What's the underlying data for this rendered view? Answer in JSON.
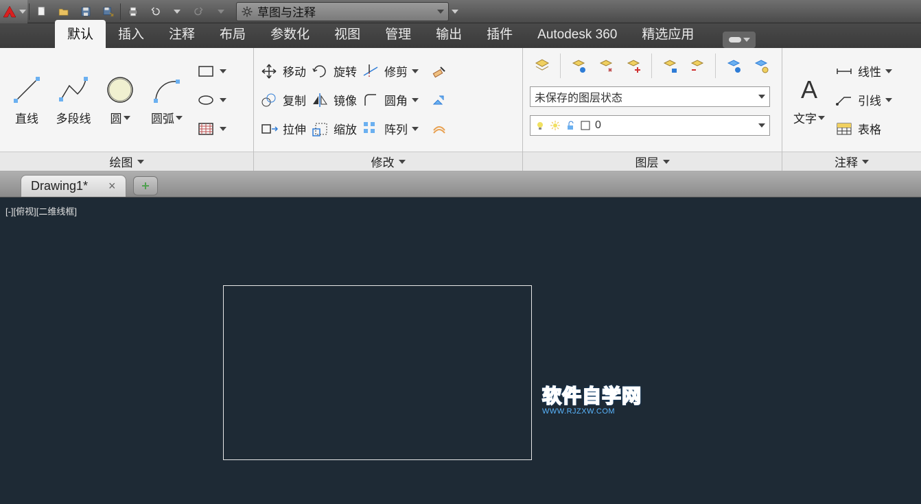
{
  "qat": {
    "workspace": "草图与注释"
  },
  "tabs": [
    "默认",
    "插入",
    "注释",
    "布局",
    "参数化",
    "视图",
    "管理",
    "输出",
    "插件",
    "Autodesk 360",
    "精选应用"
  ],
  "activeTab": "默认",
  "ribbon": {
    "draw": {
      "title": "绘图",
      "line": "直线",
      "polyline": "多段线",
      "circle": "圆",
      "arc": "圆弧"
    },
    "modify": {
      "title": "修改",
      "move": "移动",
      "copy": "复制",
      "stretch": "拉伸",
      "rotate": "旋转",
      "mirror": "镜像",
      "scale": "缩放",
      "trim": "修剪",
      "fillet": "圆角",
      "array": "阵列"
    },
    "layer": {
      "title": "图层",
      "state": "未保存的图层状态",
      "current": "0"
    },
    "annot": {
      "title": "注释",
      "text": "文字",
      "linear": "线性",
      "leader": "引线",
      "table": "表格"
    }
  },
  "document": {
    "tab": "Drawing1*"
  },
  "canvas": {
    "viewlabel": "[-][俯视][二维线框]"
  },
  "watermark": {
    "line1": "软件自学网",
    "line2": "WWW.RJZXW.COM"
  }
}
